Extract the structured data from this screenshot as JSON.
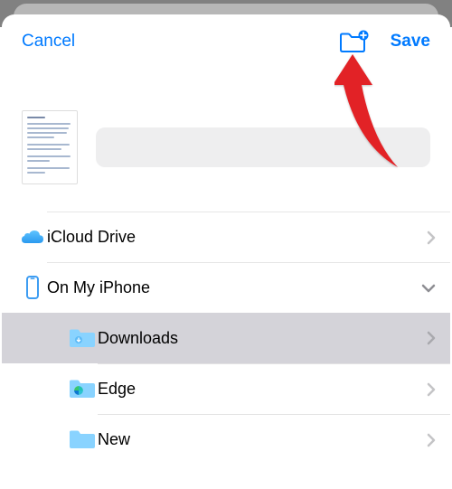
{
  "toolbar": {
    "cancel_label": "Cancel",
    "save_label": "Save",
    "new_folder_icon": "new-folder-plus-icon"
  },
  "preview": {
    "thumbnail_desc": "document-thumbnail",
    "filename_value": ""
  },
  "locations": [
    {
      "id": "icloud",
      "label": "iCloud Drive",
      "icon": "cloud-icon",
      "expanded": false,
      "indent": 0
    },
    {
      "id": "on-my-iphone",
      "label": "On My iPhone",
      "icon": "iphone-icon",
      "expanded": true,
      "indent": 0
    },
    {
      "id": "downloads",
      "label": "Downloads",
      "icon": "folder-download-icon",
      "selected": true,
      "indent": 1
    },
    {
      "id": "edge",
      "label": "Edge",
      "icon": "folder-edge-icon",
      "indent": 1
    },
    {
      "id": "new",
      "label": "New",
      "icon": "folder-icon",
      "indent": 1
    }
  ],
  "colors": {
    "accent": "#007aff",
    "folder": "#89d3ff",
    "selected_row": "#d4d3d9",
    "annotation": "#e22428"
  },
  "annotation": {
    "type": "arrow",
    "target": "new-folder-button"
  }
}
